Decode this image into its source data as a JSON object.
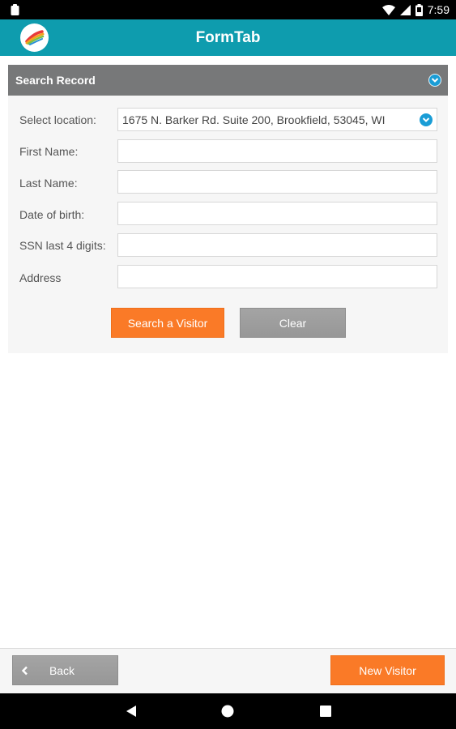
{
  "status_bar": {
    "time": "7:59",
    "icons": [
      "clipboard-icon",
      "wifi-icon",
      "signal-icon",
      "battery-icon"
    ]
  },
  "app_bar": {
    "title": "FormTab",
    "logo_icon": "app-logo-icon",
    "color": "#0e9cae"
  },
  "panel": {
    "title": "Search Record",
    "toggle_icon": "chevron-down-circle-icon",
    "fields": {
      "location": {
        "label": "Select location:",
        "value": "1675 N. Barker Rd. Suite 200, Brookfield, 53045, WI"
      },
      "first_name": {
        "label": "First Name:",
        "value": ""
      },
      "last_name": {
        "label": "Last Name:",
        "value": ""
      },
      "dob": {
        "label": "Date of birth:",
        "value": ""
      },
      "ssn": {
        "label": "SSN last 4 digits:",
        "value": ""
      },
      "address": {
        "label": "Address",
        "value": ""
      }
    },
    "buttons": {
      "search": "Search a Visitor",
      "clear": "Clear"
    }
  },
  "footer": {
    "back_label": "Back",
    "back_icon": "chevron-left-icon",
    "new_visitor_label": "New Visitor"
  },
  "colors": {
    "accent_orange": "#fa7a27",
    "header_gray": "#777879",
    "button_gray": "#9e9e9e",
    "toggle_blue": "#1a9dd6"
  },
  "nav_bar": {
    "icons": [
      "back-triangle-icon",
      "home-circle-icon",
      "recents-square-icon"
    ]
  }
}
